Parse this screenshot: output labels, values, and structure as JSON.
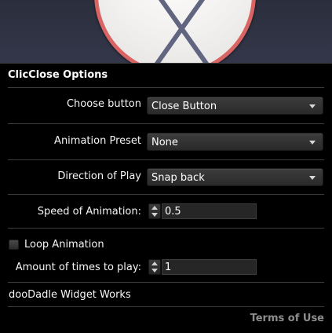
{
  "app": {
    "title": "ClicClose Options"
  },
  "preview": {
    "icon": "close-x-icon",
    "ring_color": "#d86464",
    "disc_color": "#f1f0ee",
    "x_color": "#626580"
  },
  "options": {
    "choose_button": {
      "label": "Choose button",
      "value": "Close Button"
    },
    "animation_preset": {
      "label": "Animation Preset",
      "value": "None"
    },
    "direction_of_play": {
      "label": "Direction of Play",
      "value": "Snap back"
    },
    "speed_of_animation": {
      "label": "Speed of Animation:",
      "value": "0.5"
    },
    "loop_animation": {
      "label": "Loop Animation",
      "checked": false
    },
    "amount_of_times": {
      "label": "Amount of times to play:",
      "value": "1"
    }
  },
  "footer": {
    "brand": "dooDadle Widget Works",
    "terms_link": "Terms of Use"
  }
}
